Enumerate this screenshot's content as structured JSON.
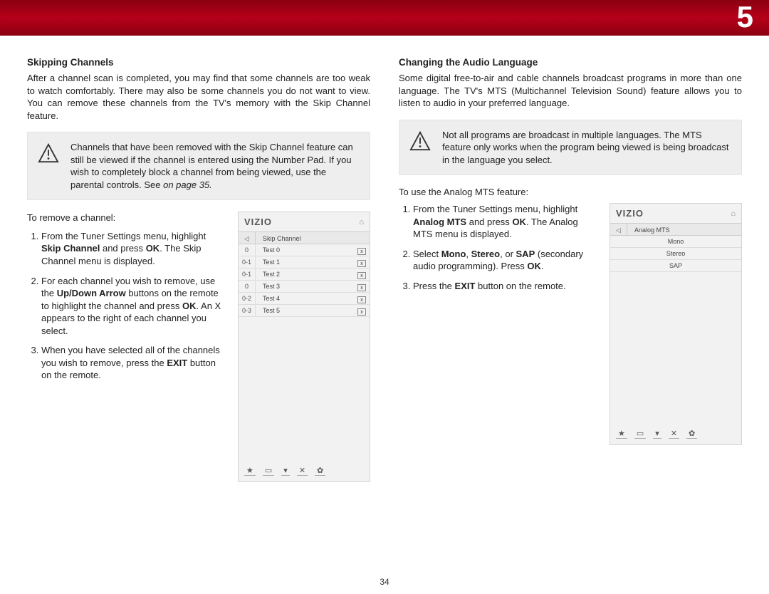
{
  "section_number": "5",
  "page_number": "34",
  "left": {
    "heading": "Skipping Channels",
    "intro": "After a channel scan is completed, you may find that some channels are too weak to watch comfortably. There may also be some channels you do not want to view. You can remove these channels from the TV's memory with the Skip Channel feature.",
    "note": "Channels that have been removed with the Skip Channel feature can still be viewed if the channel is entered using the Number Pad. If you wish to completely block a channel from being viewed, use the parental controls. See",
    "note_ref": " on page 35.",
    "lead_in": "To remove a channel:",
    "steps": [
      {
        "pre": "From the Tuner Settings menu, highlight ",
        "b1": "Skip Channel",
        "mid": " and press ",
        "b2": "OK",
        "post": ". The Skip Channel menu is displayed."
      },
      {
        "pre": "For each channel you wish to remove, use the ",
        "b1": "Up/Down Arrow",
        "mid": " buttons on the remote to highlight the channel and press ",
        "b2": "OK",
        "post": ". An X appears to the right of each channel you select."
      },
      {
        "pre": "When you have selected all of the channels you wish to remove, press the ",
        "b1": "EXIT",
        "mid": " button on the remote.",
        "b2": "",
        "post": ""
      }
    ],
    "screen": {
      "brand": "VIZIO",
      "title": "Skip Channel",
      "rows": [
        {
          "num": "0",
          "name": "Test 0",
          "x": "x"
        },
        {
          "num": "0-1",
          "name": "Test 1",
          "x": "x"
        },
        {
          "num": "0-1",
          "name": "Test 2",
          "x": "x"
        },
        {
          "num": "0",
          "name": "Test 3",
          "x": "x"
        },
        {
          "num": "0-2",
          "name": "Test 4",
          "x": "x"
        },
        {
          "num": "0-3",
          "name": "Test 5",
          "x": "x"
        }
      ]
    }
  },
  "right": {
    "heading": "Changing the Audio Language",
    "intro": "Some digital free-to-air and cable channels broadcast programs in more than one language. The TV's MTS (Multichannel Television Sound) feature allows you to listen to audio in your preferred language.",
    "note": "Not all programs are broadcast in multiple languages. The MTS feature only works when the program being viewed is being broadcast in the language you select.",
    "lead_in": "To use the Analog MTS feature:",
    "steps": [
      {
        "pre": "From the Tuner Settings menu, highlight ",
        "b1": "Analog MTS",
        "mid": " and press ",
        "b2": "OK",
        "post": ". The Analog MTS menu is displayed."
      },
      {
        "pre": "Select ",
        "b1": "Mono",
        "mid": ", ",
        "b2": "Stereo",
        "mid2": ", or ",
        "b3": "SAP",
        "post": " (secondary audio programming). Press ",
        "b4": "OK",
        "post2": "."
      },
      {
        "pre": "Press the ",
        "b1": "EXIT",
        "mid": " button on the remote.",
        "b2": "",
        "post": ""
      }
    ],
    "screen": {
      "brand": "VIZIO",
      "title": "Analog MTS",
      "options": [
        "Mono",
        "Stereo",
        "SAP"
      ]
    }
  },
  "footer_icons": {
    "star": "★",
    "cc": "▭",
    "v": "❤",
    "x": "✕",
    "gear": "✿"
  }
}
